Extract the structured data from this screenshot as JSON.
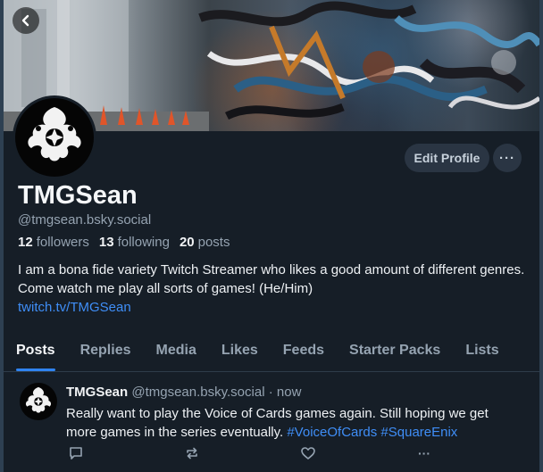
{
  "profile": {
    "display_name": "TMGSean",
    "handle": "@tmgsean.bsky.social",
    "followers_count": "12",
    "followers_label": "followers",
    "following_count": "13",
    "following_label": "following",
    "posts_count": "20",
    "posts_label": "posts",
    "bio_line1": "I am a bona fide variety Twitch Streamer who likes a good amount of different genres. Come watch me play all sorts of games! (He/Him)",
    "bio_link": "twitch.tv/TMGSean"
  },
  "buttons": {
    "edit_profile": "Edit Profile",
    "more": "···"
  },
  "tabs": [
    {
      "label": "Posts",
      "active": true
    },
    {
      "label": "Replies",
      "active": false
    },
    {
      "label": "Media",
      "active": false
    },
    {
      "label": "Likes",
      "active": false
    },
    {
      "label": "Feeds",
      "active": false
    },
    {
      "label": "Starter Packs",
      "active": false
    },
    {
      "label": "Lists",
      "active": false
    }
  ],
  "post": {
    "author": "TMGSean",
    "handle": "@tmgsean.bsky.social",
    "separator": "·",
    "time": "now",
    "text": "Really want to play the Voice of Cards games again. Still hoping we get more games in the series eventually.",
    "tag1": "#VoiceOfCards",
    "tag2": "#SquareEnix",
    "more_label": "···"
  },
  "icons": {
    "back": "chevron-left-icon",
    "reply": "speech-bubble-icon",
    "repost": "repost-arrows-icon",
    "like": "heart-icon",
    "more": "ellipsis-icon"
  },
  "colors": {
    "background": "#161e27",
    "accent": "#2f83f0",
    "link": "#3f8ef7",
    "muted": "#95a3b1",
    "button_bg": "#2a3543"
  }
}
